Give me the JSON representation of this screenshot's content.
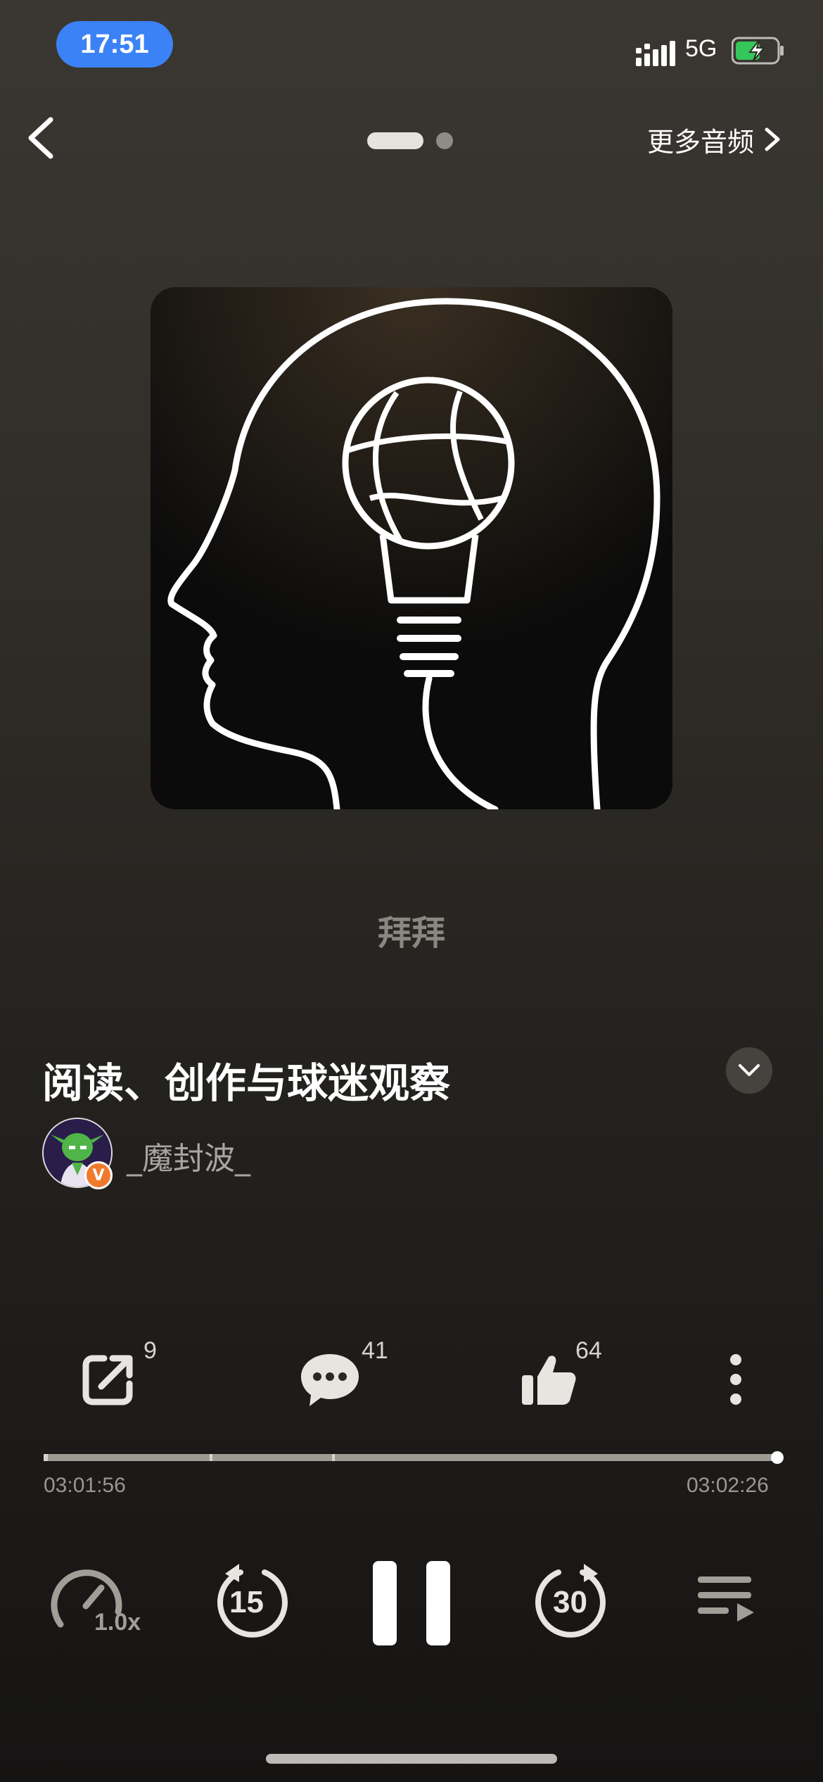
{
  "status_bar": {
    "time": "17:51",
    "network": "5G"
  },
  "top_nav": {
    "more_audio_label": "更多音频",
    "page_count": 2,
    "active_page": 1
  },
  "cover": {
    "icon": "head-lightbulb-basketball-icon"
  },
  "lyric_text": "拜拜",
  "episode": {
    "title": "阅读、创作与球迷观察",
    "author": "_魔封波_",
    "author_badge": "V"
  },
  "actions": {
    "share_count": "9",
    "comment_count": "41",
    "like_count": "64"
  },
  "progress": {
    "elapsed": "03:01:56",
    "total": "03:02:26",
    "fraction": 0.997
  },
  "controls": {
    "speed_label": "1.0x",
    "rewind_seconds": "15",
    "forward_seconds": "30"
  },
  "colors": {
    "accent_blue": "#3b82f6",
    "battery_green": "#34c759",
    "badge_orange": "#f07a2c"
  }
}
